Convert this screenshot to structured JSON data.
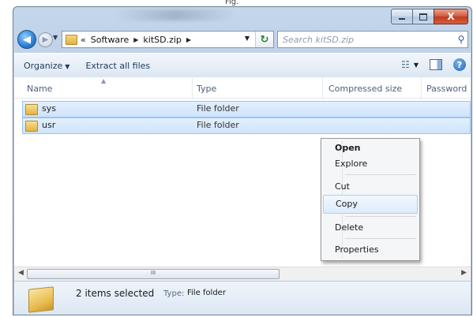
{
  "page_label": "Fig.",
  "window": {
    "close_label": "X"
  },
  "nav": {
    "back_glyph": "◀",
    "forward_glyph": "▶",
    "breadcrumb_prefix": "«",
    "breadcrumb": [
      "Software",
      "kitSD.zip"
    ],
    "search_placeholder": "Search kitSD.zip"
  },
  "toolbar": {
    "organize_label": "Organize",
    "extract_label": "Extract all files"
  },
  "columns": {
    "name": "Name",
    "type": "Type",
    "compressed_size": "Compressed size",
    "password": "Password"
  },
  "files": [
    {
      "name": "sys",
      "type": "File folder"
    },
    {
      "name": "usr",
      "type": "File folder"
    }
  ],
  "context_menu": {
    "open": "Open",
    "explore": "Explore",
    "cut": "Cut",
    "copy": "Copy",
    "delete": "Delete",
    "properties": "Properties"
  },
  "scrollbar": {
    "thumb_grip": "III"
  },
  "details": {
    "selection_text": "2 items selected",
    "type_label": "Type:",
    "type_value": "File folder"
  }
}
